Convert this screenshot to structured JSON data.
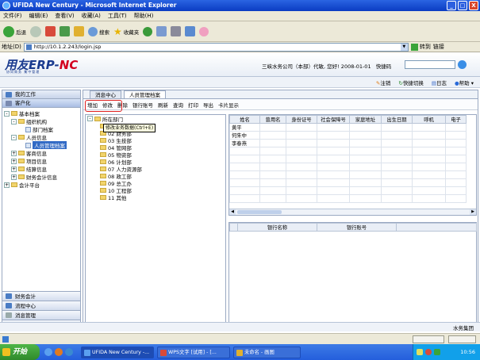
{
  "window": {
    "title": "UFIDA New Century - Microsoft Internet Explorer",
    "min": "_",
    "max": "□",
    "close": "X"
  },
  "menu": [
    "文件(F)",
    "编辑(E)",
    "查看(V)",
    "收藏(A)",
    "工具(T)",
    "帮助(H)"
  ],
  "toolbar": {
    "back": "后退",
    "search": "搜索",
    "favorites": "收藏夹"
  },
  "address": {
    "label": "地址(D)",
    "url": "http://10.1.2.243/login.jsp",
    "go": "转到",
    "links": "链接"
  },
  "header": {
    "logo_main": "用友ERP-",
    "logo_nc": "NC",
    "logo_sub": "协同商务   集中管理",
    "company": "三峡水务公司（本部）代敏, 您好! 2008-01-01",
    "quicklink_label": "快捷码"
  },
  "subbar": {
    "logout": "注销",
    "quickswitch": "快捷切换",
    "log": "日志",
    "help": "帮助"
  },
  "nav": {
    "top_items": [
      "我的工作",
      "客户化"
    ],
    "tree": [
      {
        "pm": "-",
        "icon": "folder",
        "label": "基本档案",
        "indent": 0
      },
      {
        "pm": "-",
        "icon": "folder",
        "label": "组织机构",
        "indent": 1
      },
      {
        "pm": "",
        "icon": "leaf",
        "label": "部门档案",
        "indent": 2
      },
      {
        "pm": "-",
        "icon": "folder",
        "label": "人员信息",
        "indent": 1
      },
      {
        "pm": "",
        "icon": "leaf",
        "label": "人员管理档案",
        "indent": 2,
        "selected": true
      },
      {
        "pm": "+",
        "icon": "folder",
        "label": "客商信息",
        "indent": 1
      },
      {
        "pm": "+",
        "icon": "folder",
        "label": "项目信息",
        "indent": 1
      },
      {
        "pm": "+",
        "icon": "folder",
        "label": "结算信息",
        "indent": 1
      },
      {
        "pm": "+",
        "icon": "folder",
        "label": "财务会计信息",
        "indent": 1
      },
      {
        "pm": "+",
        "icon": "folder",
        "label": "会计平台",
        "indent": 0
      }
    ],
    "bottom_items": [
      "财务会计",
      "流程中心",
      "消息管理"
    ]
  },
  "tabs": [
    "消息中心",
    "人员管理档案"
  ],
  "actions": [
    "增加",
    "修改",
    "删除",
    "银行账号",
    "刷新",
    "查询",
    "打印",
    "导出",
    "卡片显示"
  ],
  "tooltip": "修改业务数据(Ctrl+E)",
  "dept": {
    "root": "所在部门",
    "items": [
      "01 财务部",
      "02 财务部",
      "03 生技部",
      "04 管网部",
      "05 物资部",
      "06 计划部",
      "07 人力资源部",
      "08 政工部",
      "09 总工办",
      "10 工程部",
      "11 其他"
    ]
  },
  "person_table": {
    "columns": [
      "姓名",
      "曾用名",
      "身份证号",
      "社会保障号",
      "家庭地址",
      "出生日期",
      "呼机",
      "电子"
    ],
    "rows": [
      [
        "黄平",
        "",
        "",
        "",
        "",
        "",
        "",
        ""
      ],
      [
        "何朱中",
        "",
        "",
        "",
        "",
        "",
        "",
        ""
      ],
      [
        "李春燕",
        "",
        "",
        "",
        "",
        "",
        "",
        ""
      ]
    ]
  },
  "bank_table": {
    "columns": [
      "银行名称",
      "银行账号"
    ]
  },
  "status": {
    "right": "水务集团"
  },
  "taskbar": {
    "start": "开始",
    "tasks": [
      "UFIDA New Century -...",
      "WPS文字 [试用] - [...",
      "未命名 - 画图"
    ],
    "clock": "10:56"
  }
}
